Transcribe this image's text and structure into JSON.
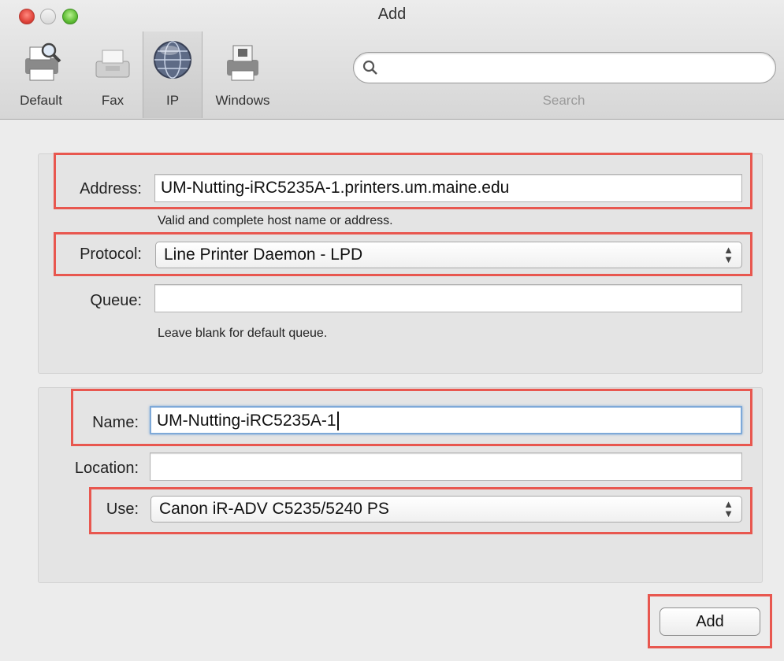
{
  "window": {
    "title": "Add"
  },
  "toolbar": {
    "tabs": [
      {
        "label": "Default",
        "icon": "printer-magnifier-icon"
      },
      {
        "label": "Fax",
        "icon": "fax-icon"
      },
      {
        "label": "IP",
        "icon": "globe-icon",
        "selected": true
      },
      {
        "label": "Windows",
        "icon": "windows-printer-icon"
      }
    ],
    "search": {
      "label": "Search",
      "value": ""
    }
  },
  "ip_form": {
    "address": {
      "label": "Address:",
      "value": "UM-Nutting-iRC5235A-1.printers.um.maine.edu",
      "hint": "Valid and complete host name or address."
    },
    "protocol": {
      "label": "Protocol:",
      "value": "Line Printer Daemon - LPD"
    },
    "queue": {
      "label": "Queue:",
      "value": "",
      "hint": "Leave blank for default queue."
    }
  },
  "printer_form": {
    "name": {
      "label": "Name:",
      "value": "UM-Nutting-iRC5235A-1"
    },
    "location": {
      "label": "Location:",
      "value": ""
    },
    "use": {
      "label": "Use:",
      "value": "Canon iR-ADV C5235/5240 PS"
    }
  },
  "actions": {
    "add_label": "Add"
  },
  "colors": {
    "highlight": "#e8574f",
    "focus_ring": "#7ea9d8"
  }
}
